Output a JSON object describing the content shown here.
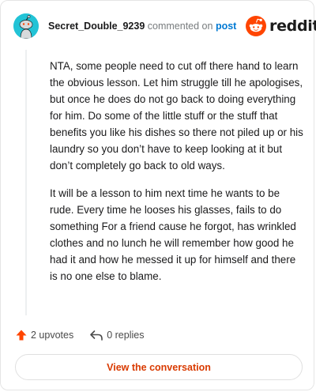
{
  "header": {
    "username": "Secret_Double_9239",
    "commented_text": "commented on",
    "post_link": "post",
    "brand": "reddit"
  },
  "comment": {
    "paragraphs": [
      "NTA, some people need to cut off there hand to learn the obvious lesson. Let him struggle till he apologises, but once he does do not go back to doing everything for him. Do some of the little stuff or the stuff that benefits you like his dishes so there not piled up or his laundry so you don’t have to keep looking at it but don’t completely go back to old ways.",
      "It will be a lesson to him next time he wants to be rude. Every time he looses his glasses, fails to do something For a friend cause he forgot, has wrinkled clothes and no lunch he will remember how good he had it and how he messed it up for himself and there is no one else to blame."
    ]
  },
  "actions": {
    "upvotes_label": "2 upvotes",
    "replies_label": "0 replies"
  },
  "button": {
    "view_label": "View the conversation"
  },
  "icons": {
    "avatar": "snoo-avatar-icon",
    "brand": "reddit-logo-icon",
    "upvote": "upvote-arrow-icon",
    "reply": "reply-arrow-icon"
  },
  "colors": {
    "avatar_bg": "#22c3d6",
    "link": "#0079d3",
    "brand_orange": "#ff4500",
    "button_text": "#d93a00"
  }
}
